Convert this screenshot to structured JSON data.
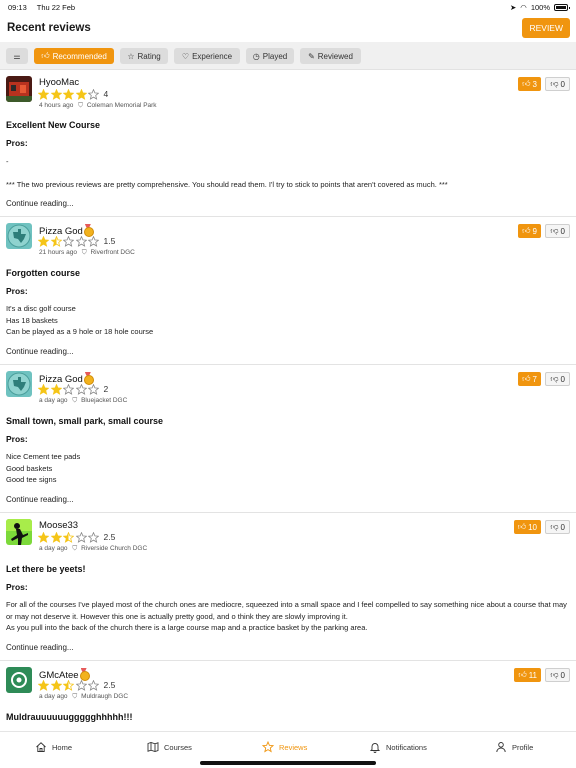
{
  "status_bar": {
    "time": "09:13",
    "date": "Thu 22 Feb",
    "battery": "100%"
  },
  "header": {
    "title": "Recent reviews",
    "review_button": "REVIEW"
  },
  "filters": [
    {
      "label": "",
      "icon": "sliders-icon",
      "active": false
    },
    {
      "label": "Recommended",
      "icon": "thumbs-up-icon",
      "active": true
    },
    {
      "label": "Rating",
      "icon": "star-icon",
      "active": false
    },
    {
      "label": "Experience",
      "icon": "heart-icon",
      "active": false
    },
    {
      "label": "Played",
      "icon": "clock-icon",
      "active": false
    },
    {
      "label": "Reviewed",
      "icon": "pencil-icon",
      "active": false
    }
  ],
  "reviews": [
    {
      "user": "HyooMac",
      "medal": false,
      "rating": 4,
      "rating_label": "4",
      "time": "4 hours ago",
      "course": "Coleman Memorial Park",
      "likes": "3",
      "dislikes": "0",
      "title": "Excellent New Course",
      "pros_label": "Pros:",
      "body": [
        "-",
        "",
        "*** The two previous reviews are pretty comprehensive. You should read them. I'l try to stick to points that aren't covered as much. ***"
      ],
      "continue": "Continue reading..."
    },
    {
      "user": "Pizza God",
      "medal": true,
      "rating": 1.5,
      "rating_label": "1.5",
      "time": "21 hours ago",
      "course": "Riverfront DGC",
      "likes": "9",
      "dislikes": "0",
      "title": "Forgotten course",
      "pros_label": "Pros:",
      "body": [
        "It's a disc golf course",
        "Has 18 baskets",
        "Can be played as a 9 hole or 18 hole course"
      ],
      "continue": "Continue reading..."
    },
    {
      "user": "Pizza God",
      "medal": true,
      "rating": 2,
      "rating_label": "2",
      "time": "a day ago",
      "course": "Bluejacket DGC",
      "likes": "7",
      "dislikes": "0",
      "title": "Small town, small park, small course",
      "pros_label": "Pros:",
      "body": [
        "Nice Cement tee pads",
        "Good baskets",
        "Good tee signs"
      ],
      "continue": "Continue reading..."
    },
    {
      "user": "Moose33",
      "medal": false,
      "rating": 2.5,
      "rating_label": "2.5",
      "time": "a day ago",
      "course": "Riverside Church DGC",
      "likes": "10",
      "dislikes": "0",
      "title": "Let there be yeets!",
      "pros_label": "Pros:",
      "body": [
        "For all of the courses I've played most of the church ones are mediocre, squeezed into a small space and I feel compelled to say something nice about a course that may or may not deserve it. However this one is actually pretty good, and o think they are slowly improving it.",
        "As you pull into the back of the church there is a large course map and a practice basket by the parking area."
      ],
      "continue": "Continue reading..."
    },
    {
      "user": "GMcAtee",
      "medal": true,
      "rating": 2.5,
      "rating_label": "2.5",
      "time": "a day ago",
      "course": "Muldraugh DGC",
      "likes": "11",
      "dislikes": "0",
      "title": "Muldrauuuuuuggggghhhhh!!!",
      "pros_label": "",
      "body": [],
      "continue": ""
    }
  ],
  "tabs": [
    {
      "label": "Home",
      "icon": "home-icon",
      "active": false
    },
    {
      "label": "Courses",
      "icon": "map-icon",
      "active": false
    },
    {
      "label": "Reviews",
      "icon": "star-icon",
      "active": true
    },
    {
      "label": "Notifications",
      "icon": "bell-icon",
      "active": false
    },
    {
      "label": "Profile",
      "icon": "person-icon",
      "active": false
    }
  ],
  "colors": {
    "accent": "#f0950f",
    "star": "#f5c518"
  }
}
